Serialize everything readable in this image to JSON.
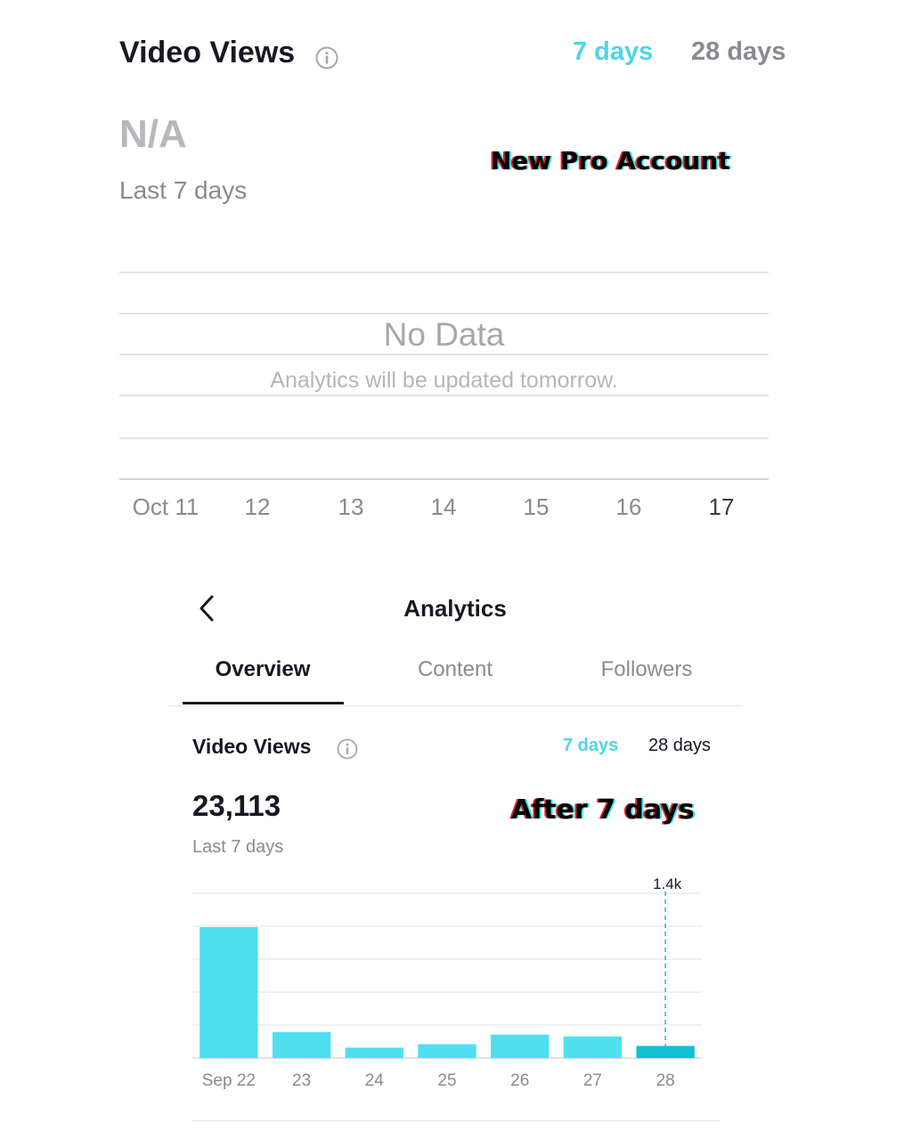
{
  "top_panel": {
    "title": "Video Views",
    "tabs": {
      "seven_days": "7 days",
      "twenty_eight_days": "28 days",
      "active": "seven_days"
    },
    "value": "N/A",
    "period": "Last 7 days",
    "overlay_label": "New Pro Account",
    "empty_state": {
      "title": "No Data",
      "message": "Analytics will be updated tomorrow."
    },
    "x_labels": [
      "Oct 11",
      "12",
      "13",
      "14",
      "15",
      "16",
      "17"
    ]
  },
  "bottom_panel": {
    "header": {
      "title": "Analytics"
    },
    "tabs": {
      "overview": "Overview",
      "content": "Content",
      "followers": "Followers",
      "active": "overview"
    },
    "card": {
      "title": "Video Views",
      "range_tabs": {
        "seven_days": "7 days",
        "twenty_eight_days": "28 days",
        "active": "seven_days"
      },
      "value": "23,113",
      "period": "Last 7 days"
    },
    "overlay_label": "After 7 days"
  },
  "colors": {
    "accent": "#4dd5e8",
    "bar": "#50dfef",
    "bar_selected": "#10c0d6",
    "text_primary": "#161823",
    "text_secondary": "#8a8b91"
  },
  "icons": {
    "info": "info-circle-icon",
    "back": "chevron-left-icon"
  },
  "chart_data": {
    "type": "bar",
    "categories": [
      "Sep 22",
      "23",
      "24",
      "25",
      "26",
      "27",
      "28"
    ],
    "values": [
      15100,
      3000,
      1200,
      1600,
      2700,
      2500,
      1400
    ],
    "ylim": [
      0,
      19000
    ],
    "grid": true,
    "selected_index": 6,
    "selected_label": "1.4k"
  }
}
